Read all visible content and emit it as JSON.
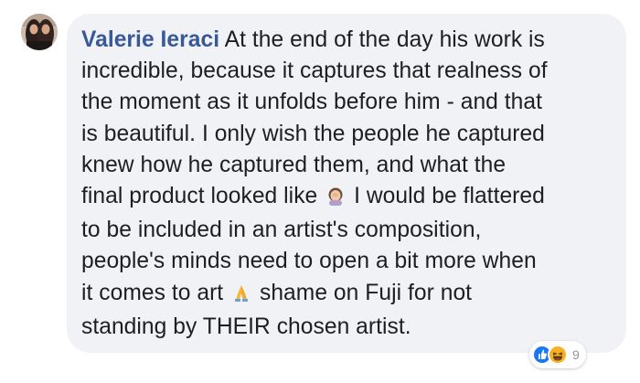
{
  "comment": {
    "author": "Valerie Ieraci",
    "text_part1": "At the end of the day his work is\nincredible, because it captures that realness of\nthe moment as it unfolds before him - and that\nis beautiful. I only wish the people he captured\nknew how he captured them, and what the\nfinal product looked like",
    "emoji1": "woman-facepalming-emoji",
    "text_part2": "I would be flattered\nto be included in an artist's composition,\npeople's minds need to open a bit more when\nit comes to art",
    "emoji2": "folded-hands-emoji",
    "text_part3": "shame on Fuji for not\nstanding by THEIR chosen artist."
  },
  "reactions": {
    "icons": [
      "like-icon",
      "haha-icon"
    ],
    "count": "9"
  },
  "colors": {
    "author": "#385898",
    "bubble": "#f1f2f6",
    "text": "#1c1e21",
    "like": "#1877f2",
    "haha": "#f7b125"
  }
}
